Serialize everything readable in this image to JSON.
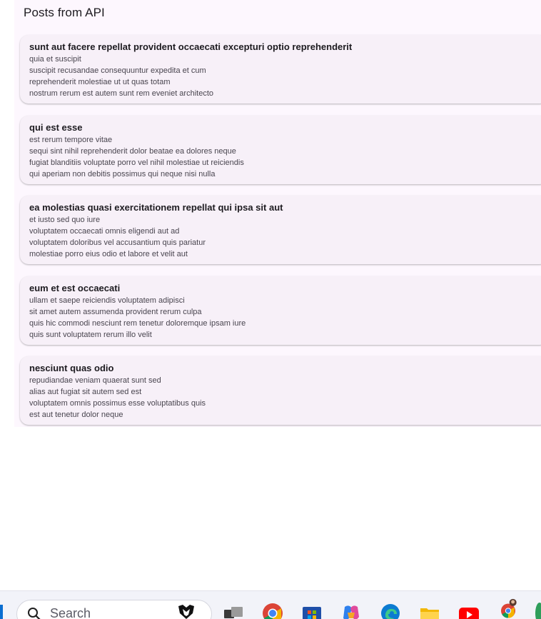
{
  "app": {
    "title": "Posts from API"
  },
  "posts": [
    {
      "title": "sunt aut facere repellat provident occaecati excepturi optio reprehenderit",
      "body": [
        "quia et suscipit",
        "suscipit recusandae consequuntur expedita et cum",
        "reprehenderit molestiae ut ut quas totam",
        "nostrum rerum est autem sunt rem eveniet architecto"
      ]
    },
    {
      "title": "qui est esse",
      "body": [
        "est rerum tempore vitae",
        "sequi sint nihil reprehenderit dolor beatae ea dolores neque",
        "fugiat blanditiis voluptate porro vel nihil molestiae ut reiciendis",
        "qui aperiam non debitis possimus qui neque nisi nulla"
      ]
    },
    {
      "title": "ea molestias quasi exercitationem repellat qui ipsa sit aut",
      "body": [
        "et iusto sed quo iure",
        "voluptatem occaecati omnis eligendi aut ad",
        "voluptatem doloribus vel accusantium quis pariatur",
        "molestiae porro eius odio et labore et velit aut"
      ]
    },
    {
      "title": "eum et est occaecati",
      "body": [
        "ullam et saepe reiciendis voluptatem adipisci",
        "sit amet autem assumenda provident rerum culpa",
        "quis hic commodi nesciunt rem tenetur doloremque ipsam iure",
        "quis sunt voluptatem rerum illo velit"
      ]
    },
    {
      "title": "nesciunt quas odio",
      "body": [
        "repudiandae veniam quaerat sunt sed",
        "alias aut fugiat sit autem sed est",
        "voluptatem omnis possimus esse voluptatibus quis",
        "est aut tenetur dolor neque"
      ]
    }
  ],
  "taskbar": {
    "search_placeholder": "Search",
    "icons": [
      "start-icon",
      "search-icon",
      "search-highlight-icon",
      "task-view-icon",
      "chrome-icon",
      "microsoft-store-icon",
      "copilot-icon",
      "edge-icon",
      "file-explorer-icon",
      "youtube-icon",
      "chrome-profile-icon"
    ]
  },
  "colors": {
    "app_background": "#fdf7fe",
    "card_background": "#f7f0f8",
    "title_text": "#1d1b20",
    "body_text": "#49454f"
  }
}
